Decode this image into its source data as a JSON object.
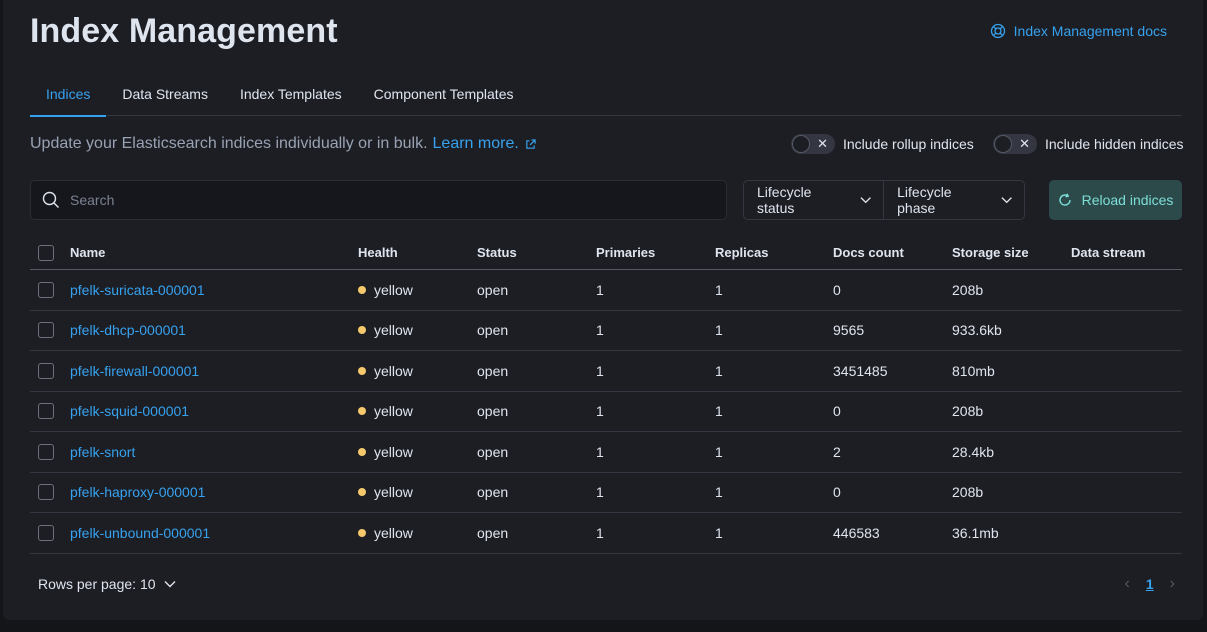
{
  "page": {
    "title": "Index Management",
    "docs_link": "Index Management docs"
  },
  "tabs": [
    {
      "label": "Indices",
      "active": true
    },
    {
      "label": "Data Streams",
      "active": false
    },
    {
      "label": "Index Templates",
      "active": false
    },
    {
      "label": "Component Templates",
      "active": false
    }
  ],
  "description": {
    "text": "Update your Elasticsearch indices individually or in bulk.",
    "link": "Learn more."
  },
  "toggles": {
    "rollup_label": "Include rollup indices",
    "hidden_label": "Include hidden indices"
  },
  "search": {
    "placeholder": "Search",
    "value": ""
  },
  "filters": {
    "lifecycle_status": "Lifecycle status",
    "lifecycle_phase": "Lifecycle phase"
  },
  "reload_label": "Reload indices",
  "table": {
    "columns": [
      "Name",
      "Health",
      "Status",
      "Primaries",
      "Replicas",
      "Docs count",
      "Storage size",
      "Data stream"
    ],
    "rows": [
      {
        "name": "pfelk-suricata-000001",
        "health": "yellow",
        "status": "open",
        "primaries": "1",
        "replicas": "1",
        "docs": "0",
        "size": "208b",
        "data_stream": ""
      },
      {
        "name": "pfelk-dhcp-000001",
        "health": "yellow",
        "status": "open",
        "primaries": "1",
        "replicas": "1",
        "docs": "9565",
        "size": "933.6kb",
        "data_stream": ""
      },
      {
        "name": "pfelk-firewall-000001",
        "health": "yellow",
        "status": "open",
        "primaries": "1",
        "replicas": "1",
        "docs": "3451485",
        "size": "810mb",
        "data_stream": ""
      },
      {
        "name": "pfelk-squid-000001",
        "health": "yellow",
        "status": "open",
        "primaries": "1",
        "replicas": "1",
        "docs": "0",
        "size": "208b",
        "data_stream": ""
      },
      {
        "name": "pfelk-snort",
        "health": "yellow",
        "status": "open",
        "primaries": "1",
        "replicas": "1",
        "docs": "2",
        "size": "28.4kb",
        "data_stream": ""
      },
      {
        "name": "pfelk-haproxy-000001",
        "health": "yellow",
        "status": "open",
        "primaries": "1",
        "replicas": "1",
        "docs": "0",
        "size": "208b",
        "data_stream": ""
      },
      {
        "name": "pfelk-unbound-000001",
        "health": "yellow",
        "status": "open",
        "primaries": "1",
        "replicas": "1",
        "docs": "446583",
        "size": "36.1mb",
        "data_stream": ""
      }
    ]
  },
  "pagination": {
    "rows_per_page": "Rows per page: 10",
    "current_page": "1"
  },
  "colors": {
    "accent": "#36a2ef",
    "health_yellow": "#f5c96b",
    "background": "#1d1e24"
  }
}
